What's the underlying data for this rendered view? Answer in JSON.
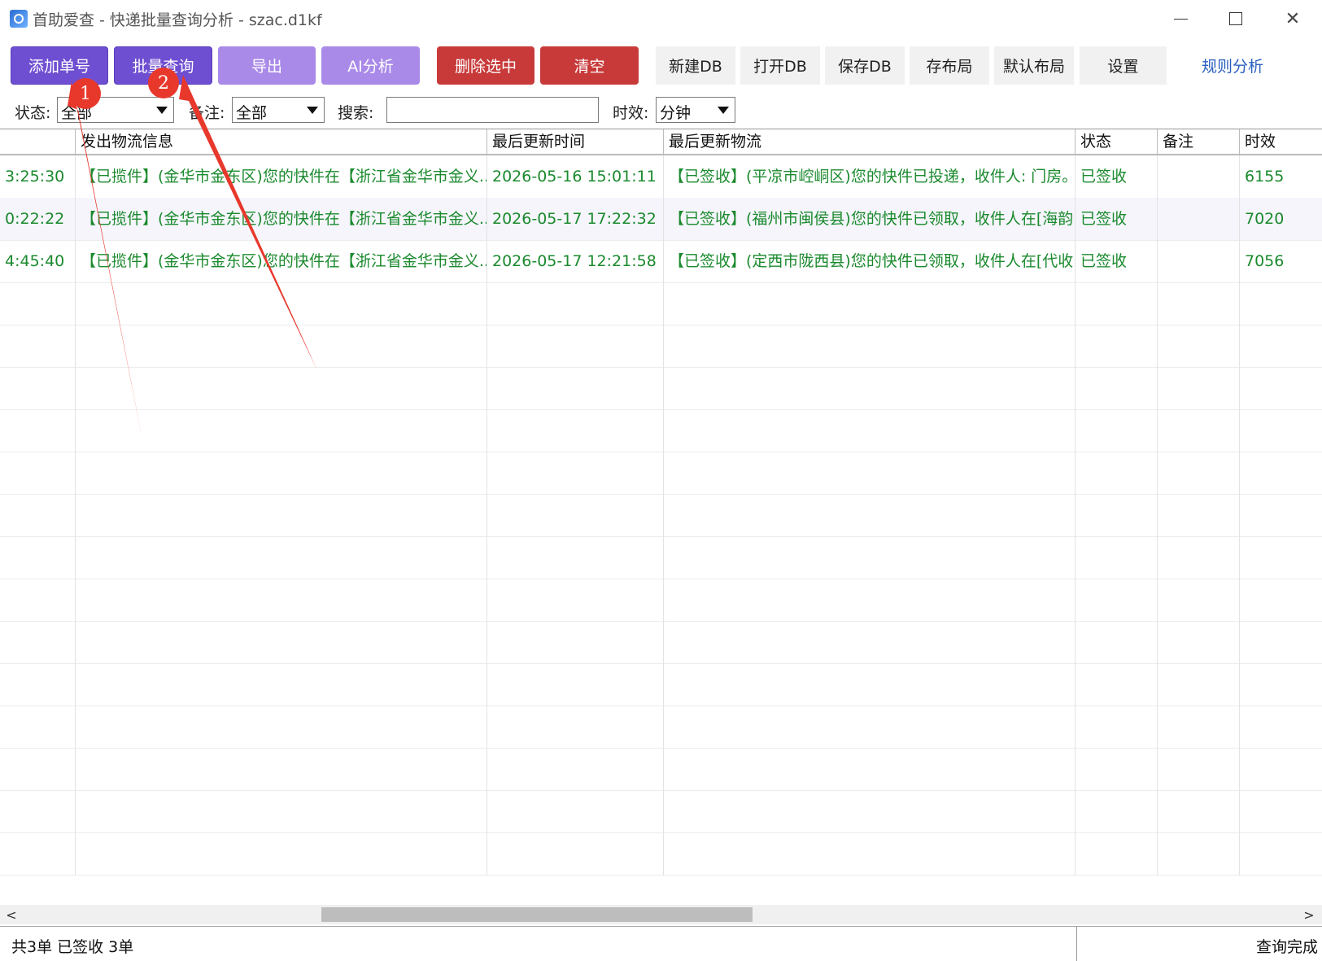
{
  "window": {
    "title": "首助爱查 - 快递批量查询分析 - szac.d1kf",
    "controls": {
      "minimize_icon": "minimize-icon",
      "maximize_icon": "maximize-icon",
      "close_icon": "close-icon",
      "close_glyph": "✕"
    }
  },
  "toolbar": {
    "add_tracking": "添加单号",
    "batch_query": "批量查询",
    "export": "导出",
    "ai_analysis": "AI分析",
    "delete_selected": "删除选中",
    "clear": "清空",
    "new_db": "新建DB",
    "open_db": "打开DB",
    "save_db": "保存DB",
    "save_layout": "存布局",
    "default_layout": "默认布局",
    "settings": "设置",
    "rule_analysis": "规则分析"
  },
  "filters": {
    "status_label": "状态:",
    "status_value": "全部",
    "note_label": "备注:",
    "note_value": "全部",
    "search_label": "搜索:",
    "search_value": "",
    "timeliness_label": "时效:",
    "timeliness_value": "分钟"
  },
  "grid": {
    "columns": [
      "",
      "发出物流信息",
      "最后更新时间",
      "最后更新物流",
      "状态",
      "备注",
      "时效"
    ],
    "rows": [
      [
        "3:25:30",
        "【已揽件】(金华市金东区)您的快件在【浙江省金华市金义...",
        "2026-05-16 15:01:11",
        "【已签收】(平凉市崆峒区)您的快件已投递，收件人: 门房。...",
        "已签收",
        "",
        "6155"
      ],
      [
        "0:22:22",
        "【已揽件】(金华市金东区)您的快件在【浙江省金华市金义...",
        "2026-05-17 17:22:32",
        "【已签收】(福州市闽侯县)您的快件已领取，收件人在[海韵...",
        "已签收",
        "",
        "7020"
      ],
      [
        "4:45:40",
        "【已揽件】(金华市金东区)您的快件在【浙江省金华市金义...",
        "2026-05-17 12:21:58",
        "【已签收】(定西市陇西县)您的快件已领取，收件人在[代收...",
        "已签收",
        "",
        "7056"
      ]
    ],
    "text_color": "#1b8a2e"
  },
  "scrollbar": {
    "left_glyph": "<",
    "right_glyph": ">"
  },
  "status": {
    "summary": "共3单  已签收 3单",
    "state": "查询完成"
  },
  "annotations": {
    "badge1": "1",
    "badge2": "2",
    "color": "#e8382c"
  },
  "colors": {
    "purple_dark": "#6f4fd1",
    "purple_light": "#a98ae8",
    "red": "#c83a3a",
    "link": "#2a5fbf"
  }
}
